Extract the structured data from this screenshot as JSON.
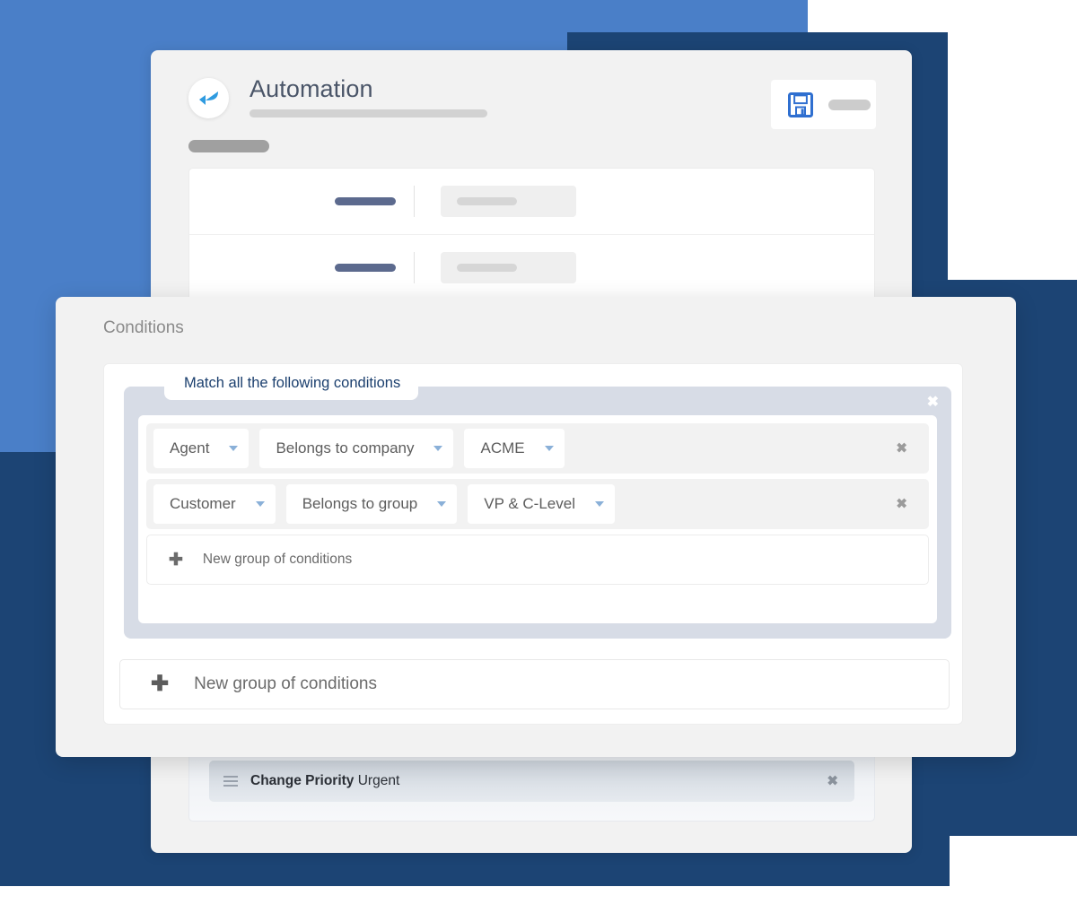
{
  "background": {
    "light_blue": "#4a7fc8",
    "navy": "#1c4474"
  },
  "automation_card": {
    "back_icon": "back-arrow-icon",
    "title": "Automation",
    "save_icon": "floppy-disk-save-icon",
    "skeleton_rows": [
      {
        "label_placeholder": "",
        "input_placeholder": ""
      },
      {
        "label_placeholder": "",
        "input_placeholder": ""
      }
    ],
    "action": {
      "drag_icon": "drag-handle-icon",
      "name": "Change Priority",
      "value": "Urgent",
      "remove_label": "✖"
    }
  },
  "conditions_modal": {
    "heading": "Conditions",
    "group": {
      "tab_label": "Match all the following conditions",
      "close_label": "✖",
      "rows": [
        {
          "subject": "Agent",
          "operator": "Belongs to company",
          "value": "ACME",
          "remove_label": "✖"
        },
        {
          "subject": "Customer",
          "operator": "Belongs to group",
          "value": "VP & C-Level",
          "remove_label": "✖"
        }
      ],
      "new_group_label": "New group of conditions",
      "new_group_icon": "plus-icon"
    },
    "new_group_outer_label": "New group of conditions",
    "new_group_outer_icon": "plus-icon"
  },
  "colors": {
    "accent_blue": "#2f80d8",
    "tab_text": "#1b3f6e",
    "caret": "#8ab0d8",
    "group_bg": "#d7dce6"
  }
}
